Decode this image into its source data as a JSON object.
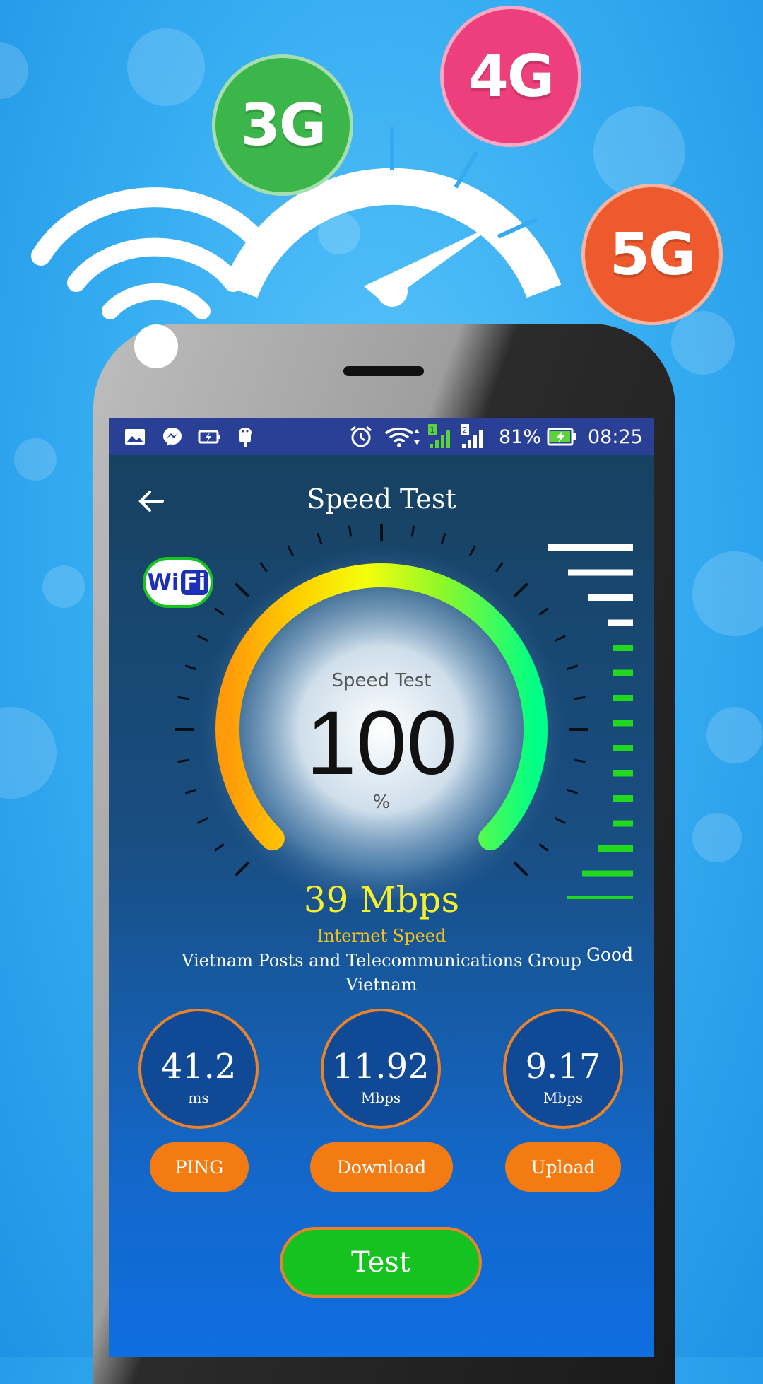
{
  "promo": {
    "badges": [
      {
        "label": "3G",
        "color": "#3cb54a"
      },
      {
        "label": "4G",
        "color": "#ec3f7c"
      },
      {
        "label": "5G",
        "color": "#ee5a2e"
      }
    ]
  },
  "status_bar": {
    "left_icons": [
      "gallery-icon",
      "messenger-icon",
      "battery-saver-icon",
      "android-debug-icon"
    ],
    "right_icons": [
      "alarm-icon",
      "wifi-icon",
      "signal-sim1-icon",
      "signal-sim2-icon",
      "battery-charging-icon"
    ],
    "battery": "81%",
    "time": "08:25"
  },
  "header": {
    "title": "Speed Test"
  },
  "wifi_logo": {
    "part1": "Wi",
    "part2": "Fi"
  },
  "gauge": {
    "label": "Speed Test",
    "value": "100",
    "unit": "%",
    "level_fraction": 1.0
  },
  "signal_meter": {
    "filled_green_bars": 12,
    "total_bars": 16,
    "label": "Good"
  },
  "result": {
    "speed": "39 Mbps",
    "speed_label": "Internet Speed",
    "isp": "Vietnam Posts and Telecommunications Group",
    "country": "Vietnam"
  },
  "stats": [
    {
      "value": "41.2",
      "unit": "ms",
      "label": "PING"
    },
    {
      "value": "11.92",
      "unit": "Mbps",
      "label": "Download"
    },
    {
      "value": "9.17",
      "unit": "Mbps",
      "label": "Upload"
    }
  ],
  "test_button": {
    "label": "Test"
  },
  "colors": {
    "status_bar": "#2a3f96",
    "accent_orange": "#f37b12",
    "test_green": "#15c21f",
    "speed_yellow": "#f5ef2c",
    "meter_green": "#22d81f"
  }
}
